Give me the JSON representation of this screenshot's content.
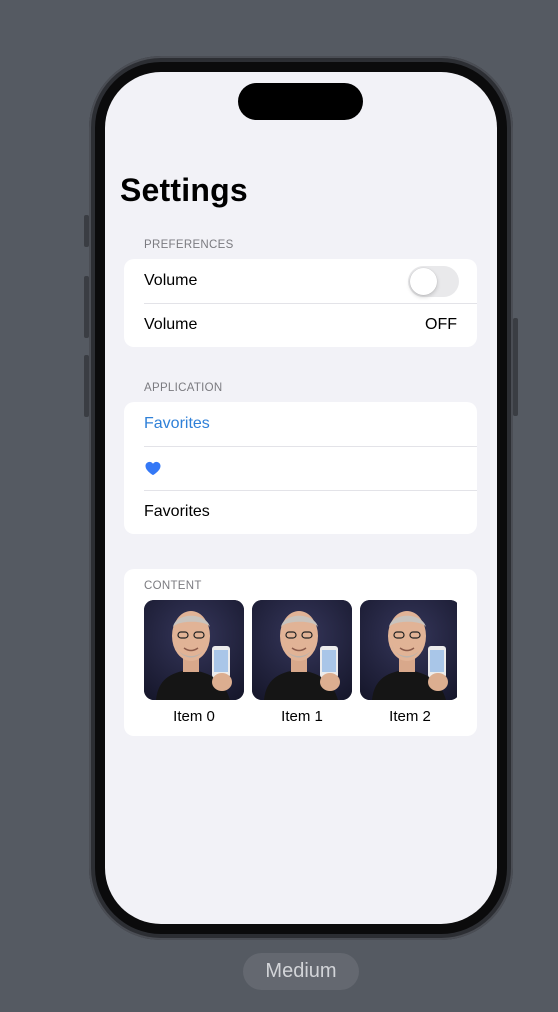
{
  "nav": {
    "title": "Settings"
  },
  "preferences": {
    "header": "PREFERENCES",
    "toggle_row": {
      "label": "Volume",
      "toggle_on": false
    },
    "value_row": {
      "label": "Volume",
      "value": "OFF"
    }
  },
  "application": {
    "header": "APPLICATION",
    "link_label": "Favorites",
    "heart_icon": "heart-fill",
    "plain_label": "Favorites",
    "accent": "#2f80d8",
    "heart_color": "#3478f6"
  },
  "content": {
    "header": "CONTENT",
    "items": [
      {
        "label": "Item 0",
        "image": "portrait-photo"
      },
      {
        "label": "Item 1",
        "image": "portrait-photo"
      },
      {
        "label": "Item 2",
        "image": "portrait-photo"
      }
    ]
  },
  "footer": {
    "size_label": "Medium"
  }
}
